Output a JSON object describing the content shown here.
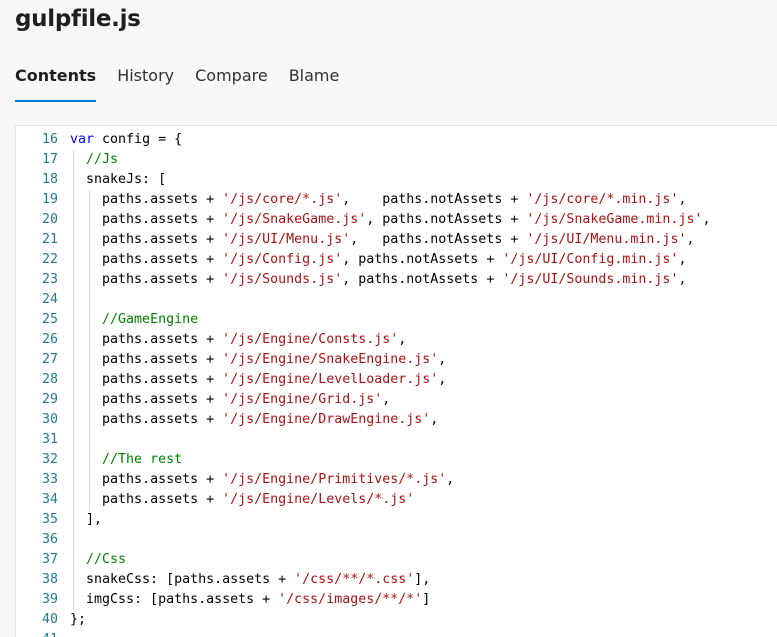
{
  "file": {
    "title": "gulpfile.js"
  },
  "tabs": [
    {
      "label": "Contents",
      "active": true
    },
    {
      "label": "History",
      "active": false
    },
    {
      "label": "Compare",
      "active": false
    },
    {
      "label": "Blame",
      "active": false
    }
  ],
  "colors": {
    "accent": "#0078d4",
    "keyword": "#0000ff",
    "string": "#a31515",
    "comment": "#008000",
    "line_number": "#237893"
  },
  "code": {
    "lines": [
      {
        "n": "16",
        "indent": 0,
        "tokens": [
          [
            "kw",
            "var"
          ],
          [
            "t",
            " config = {"
          ]
        ]
      },
      {
        "n": "17",
        "indent": 1,
        "tokens": [
          [
            "com",
            "//Js"
          ]
        ]
      },
      {
        "n": "18",
        "indent": 1,
        "tokens": [
          [
            "t",
            "snakeJs: ["
          ]
        ]
      },
      {
        "n": "19",
        "indent": 2,
        "tokens": [
          [
            "t",
            "paths.assets + "
          ],
          [
            "str",
            "'/js/core/*.js'"
          ],
          [
            "t",
            ",    paths.notAssets + "
          ],
          [
            "str",
            "'/js/core/*.min.js'"
          ],
          [
            "t",
            ","
          ]
        ]
      },
      {
        "n": "20",
        "indent": 2,
        "tokens": [
          [
            "t",
            "paths.assets + "
          ],
          [
            "str",
            "'/js/SnakeGame.js'"
          ],
          [
            "t",
            ", paths.notAssets + "
          ],
          [
            "str",
            "'/js/SnakeGame.min.js'"
          ],
          [
            "t",
            ","
          ]
        ]
      },
      {
        "n": "21",
        "indent": 2,
        "tokens": [
          [
            "t",
            "paths.assets + "
          ],
          [
            "str",
            "'/js/UI/Menu.js'"
          ],
          [
            "t",
            ",   paths.notAssets + "
          ],
          [
            "str",
            "'/js/UI/Menu.min.js'"
          ],
          [
            "t",
            ","
          ]
        ]
      },
      {
        "n": "22",
        "indent": 2,
        "tokens": [
          [
            "t",
            "paths.assets + "
          ],
          [
            "str",
            "'/js/Config.js'"
          ],
          [
            "t",
            ", paths.notAssets + "
          ],
          [
            "str",
            "'/js/UI/Config.min.js'"
          ],
          [
            "t",
            ","
          ]
        ]
      },
      {
        "n": "23",
        "indent": 2,
        "tokens": [
          [
            "t",
            "paths.assets + "
          ],
          [
            "str",
            "'/js/Sounds.js'"
          ],
          [
            "t",
            ", paths.notAssets + "
          ],
          [
            "str",
            "'/js/UI/Sounds.min.js'"
          ],
          [
            "t",
            ","
          ]
        ]
      },
      {
        "n": "24",
        "indent": 2,
        "tokens": []
      },
      {
        "n": "25",
        "indent": 2,
        "tokens": [
          [
            "com",
            "//GameEngine"
          ]
        ]
      },
      {
        "n": "26",
        "indent": 2,
        "tokens": [
          [
            "t",
            "paths.assets + "
          ],
          [
            "str",
            "'/js/Engine/Consts.js'"
          ],
          [
            "t",
            ","
          ]
        ]
      },
      {
        "n": "27",
        "indent": 2,
        "tokens": [
          [
            "t",
            "paths.assets + "
          ],
          [
            "str",
            "'/js/Engine/SnakeEngine.js'"
          ],
          [
            "t",
            ","
          ]
        ]
      },
      {
        "n": "28",
        "indent": 2,
        "tokens": [
          [
            "t",
            "paths.assets + "
          ],
          [
            "str",
            "'/js/Engine/LevelLoader.js'"
          ],
          [
            "t",
            ","
          ]
        ]
      },
      {
        "n": "29",
        "indent": 2,
        "tokens": [
          [
            "t",
            "paths.assets + "
          ],
          [
            "str",
            "'/js/Engine/Grid.js'"
          ],
          [
            "t",
            ","
          ]
        ]
      },
      {
        "n": "30",
        "indent": 2,
        "tokens": [
          [
            "t",
            "paths.assets + "
          ],
          [
            "str",
            "'/js/Engine/DrawEngine.js'"
          ],
          [
            "t",
            ","
          ]
        ]
      },
      {
        "n": "31",
        "indent": 2,
        "tokens": []
      },
      {
        "n": "32",
        "indent": 2,
        "tokens": [
          [
            "com",
            "//The rest"
          ]
        ]
      },
      {
        "n": "33",
        "indent": 2,
        "tokens": [
          [
            "t",
            "paths.assets + "
          ],
          [
            "str",
            "'/js/Engine/Primitives/*.js'"
          ],
          [
            "t",
            ","
          ]
        ]
      },
      {
        "n": "34",
        "indent": 2,
        "tokens": [
          [
            "t",
            "paths.assets + "
          ],
          [
            "str",
            "'/js/Engine/Levels/*.js'"
          ]
        ]
      },
      {
        "n": "35",
        "indent": 1,
        "tokens": [
          [
            "t",
            "],"
          ]
        ]
      },
      {
        "n": "36",
        "indent": 1,
        "tokens": []
      },
      {
        "n": "37",
        "indent": 1,
        "tokens": [
          [
            "com",
            "//Css"
          ]
        ]
      },
      {
        "n": "38",
        "indent": 1,
        "tokens": [
          [
            "t",
            "snakeCss: [paths.assets + "
          ],
          [
            "str",
            "'/css/**/*.css'"
          ],
          [
            "t",
            "],"
          ]
        ]
      },
      {
        "n": "39",
        "indent": 1,
        "tokens": [
          [
            "t",
            "imgCss: [paths.assets + "
          ],
          [
            "str",
            "'/css/images/**/*'"
          ],
          [
            "t",
            "]"
          ]
        ]
      },
      {
        "n": "40",
        "indent": 0,
        "tokens": [
          [
            "t",
            "};"
          ]
        ]
      },
      {
        "n": "41",
        "indent": 0,
        "tokens": []
      }
    ]
  }
}
